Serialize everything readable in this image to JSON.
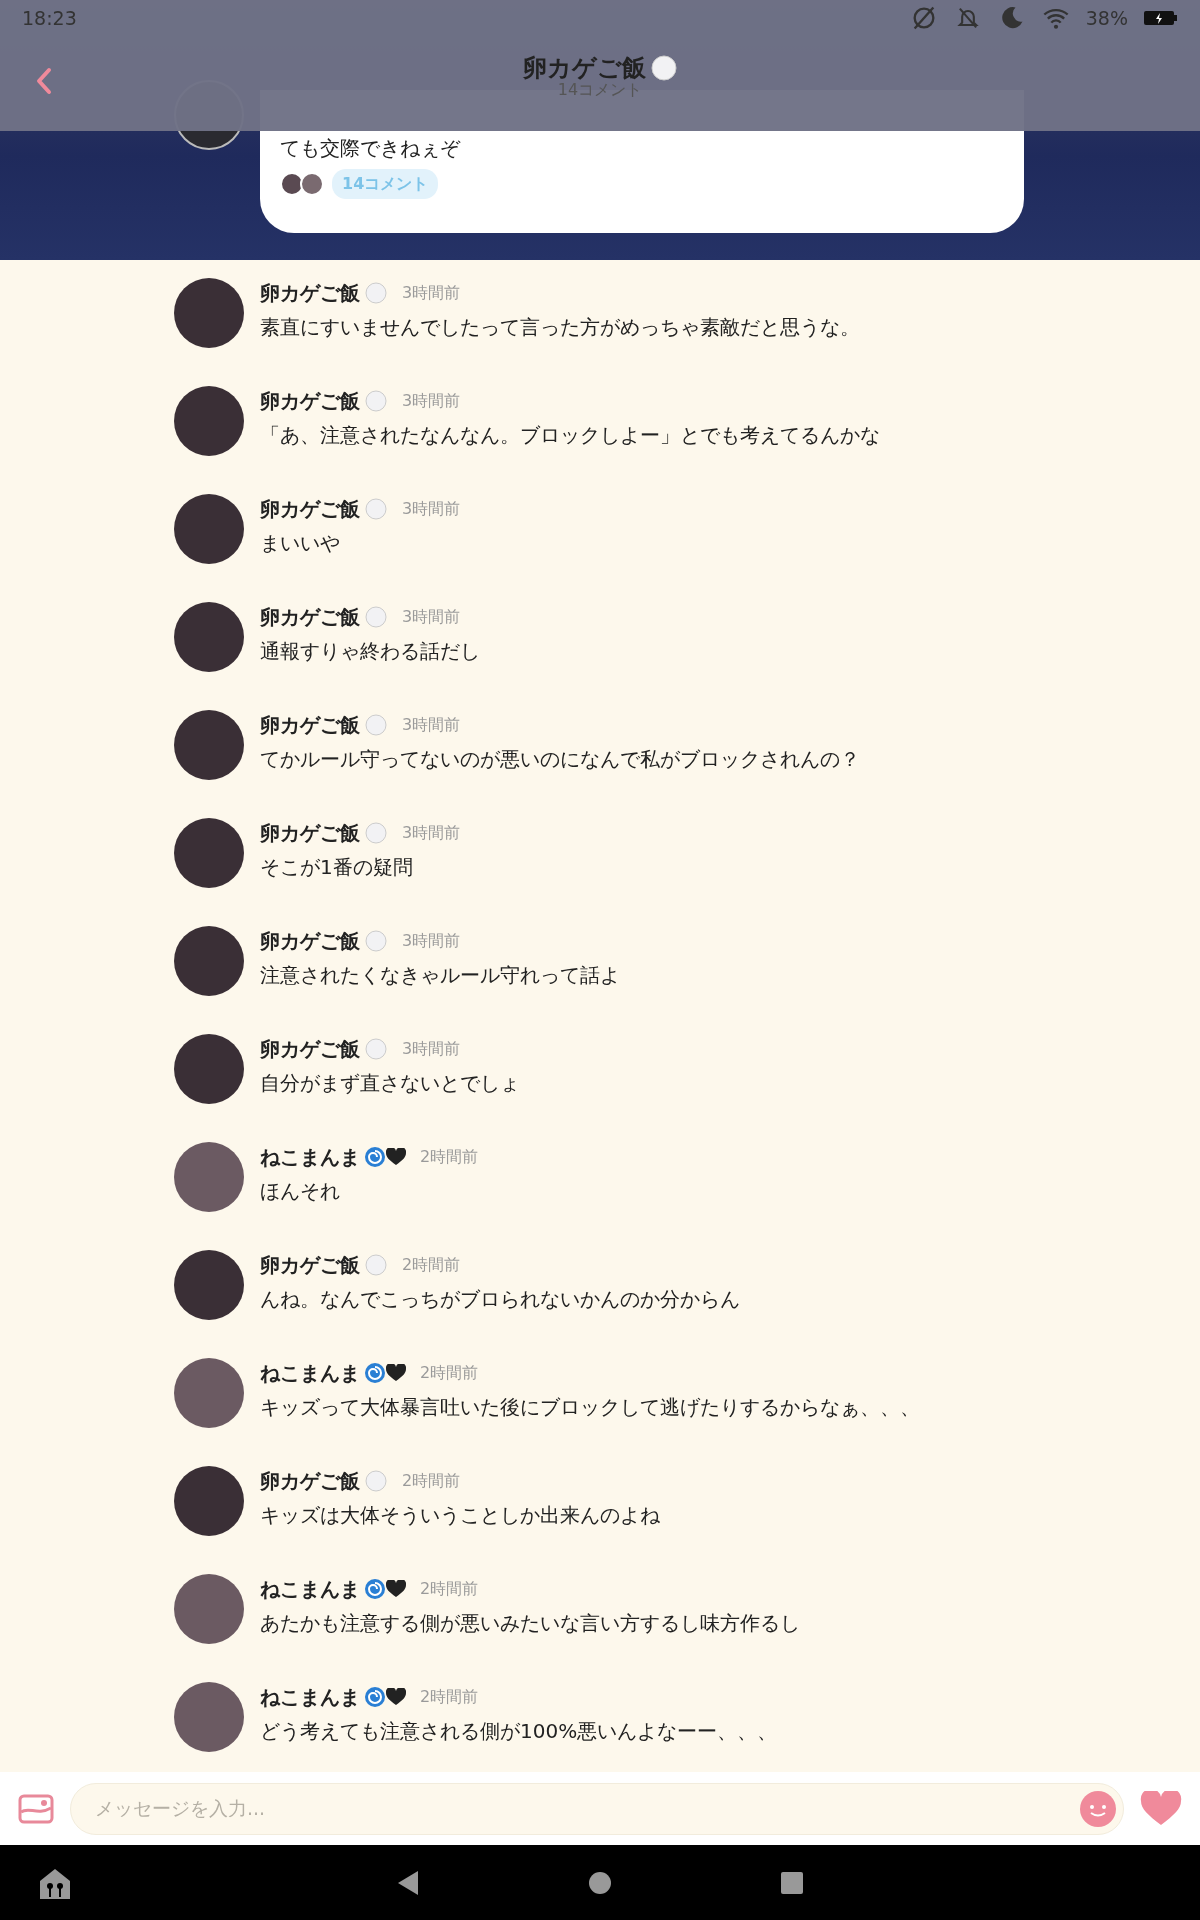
{
  "status_bar": {
    "time": "18:23",
    "battery": "38%"
  },
  "header": {
    "title": "卵カゲご飯",
    "subtitle": "14コメント"
  },
  "post": {
    "text": "ても交際できねぇぞ",
    "comment_count": "14コメント"
  },
  "comments": [
    {
      "kind": "egg",
      "author": "卵カゲご飯",
      "time": "3時間前",
      "text": "素直にすいませんでしたって言った方がめっちゃ素敵だと思うな。"
    },
    {
      "kind": "egg",
      "author": "卵カゲご飯",
      "time": "3時間前",
      "text": "「あ、注意されたなんなん。ブロックしよー」とでも考えてるんかな"
    },
    {
      "kind": "egg",
      "author": "卵カゲご飯",
      "time": "3時間前",
      "text": "まいいや"
    },
    {
      "kind": "egg",
      "author": "卵カゲご飯",
      "time": "3時間前",
      "text": "通報すりゃ終わる話だし"
    },
    {
      "kind": "egg",
      "author": "卵カゲご飯",
      "time": "3時間前",
      "text": "てかルール守ってないのが悪いのになんで私がブロックされんの？"
    },
    {
      "kind": "egg",
      "author": "卵カゲご飯",
      "time": "3時間前",
      "text": "そこが1番の疑問"
    },
    {
      "kind": "egg",
      "author": "卵カゲご飯",
      "time": "3時間前",
      "text": "注意されたくなきゃルール守れって話よ"
    },
    {
      "kind": "egg",
      "author": "卵カゲご飯",
      "time": "3時間前",
      "text": "自分がまず直さないとでしょ"
    },
    {
      "kind": "swirl",
      "author": "ねこまんま",
      "time": "2時間前",
      "text": "ほんそれ"
    },
    {
      "kind": "egg",
      "author": "卵カゲご飯",
      "time": "2時間前",
      "text": "んね。なんでこっちがブロられないかんのか分からん"
    },
    {
      "kind": "swirl",
      "author": "ねこまんま",
      "time": "2時間前",
      "text": "キッズって大体暴言吐いた後にブロックして逃げたりするからなぁ、、、"
    },
    {
      "kind": "egg",
      "author": "卵カゲご飯",
      "time": "2時間前",
      "text": "キッズは大体そういうことしか出来んのよね"
    },
    {
      "kind": "swirl",
      "author": "ねこまんま",
      "time": "2時間前",
      "text": "あたかも注意する側が悪いみたいな言い方するし味方作るし"
    },
    {
      "kind": "swirl",
      "author": "ねこまんま",
      "time": "2時間前",
      "text": "どう考えても注意される側が100%悪いんよなーー、、、"
    }
  ],
  "composer": {
    "placeholder": "メッセージを入力..."
  }
}
